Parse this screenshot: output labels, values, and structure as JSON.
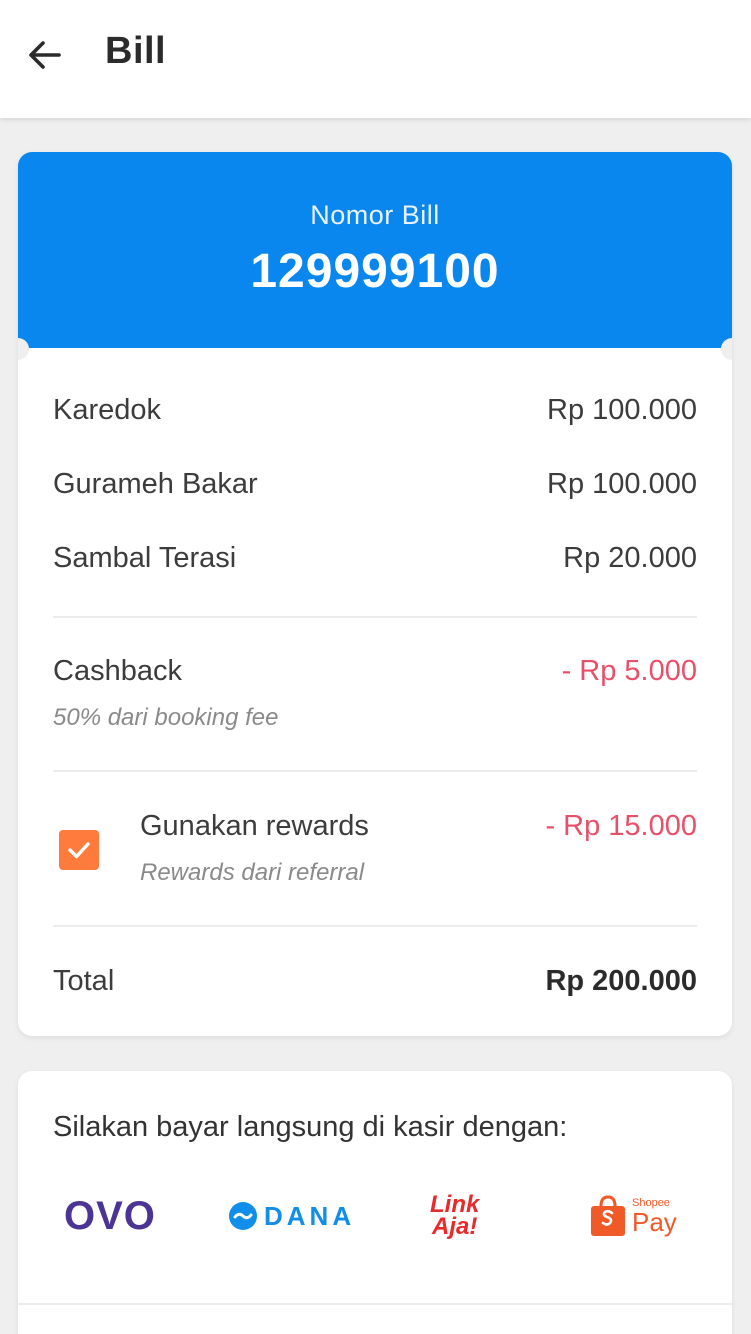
{
  "appbar": {
    "title": "Bill",
    "back_icon": "arrow-left-icon"
  },
  "bill": {
    "label": "Nomor Bill",
    "number": "129999100",
    "header_color": "#0a86ef",
    "items": [
      {
        "name": "Karedok",
        "price": "Rp 100.000"
      },
      {
        "name": "Gurameh Bakar",
        "price": "Rp 100.000"
      },
      {
        "name": "Sambal Terasi",
        "price": "Rp 20.000"
      }
    ],
    "cashback": {
      "label": "Cashback",
      "note": "50% dari booking fee",
      "amount": "- Rp 5.000"
    },
    "rewards": {
      "label": "Gunakan rewards",
      "note": "Rewards dari referral",
      "amount": "- Rp 15.000",
      "checked": true,
      "checkbox_color": "#ff7b3d"
    },
    "total": {
      "label": "Total",
      "amount": "Rp 200.000"
    },
    "negative_color": "#e8506a"
  },
  "payment": {
    "title": "Silakan bayar langsung di kasir dengan:",
    "methods": [
      {
        "name": "OVO",
        "icon": "ovo-logo-icon"
      },
      {
        "name": "DANA",
        "icon": "dana-logo-icon"
      },
      {
        "name": "LinkAja!",
        "line1": "Link",
        "line2": "Aja!",
        "icon": "linkaja-logo-icon"
      },
      {
        "name": "ShopeePay",
        "line1": "Shopee",
        "line2": "Pay",
        "icon": "shopeepay-logo-icon"
      }
    ]
  }
}
